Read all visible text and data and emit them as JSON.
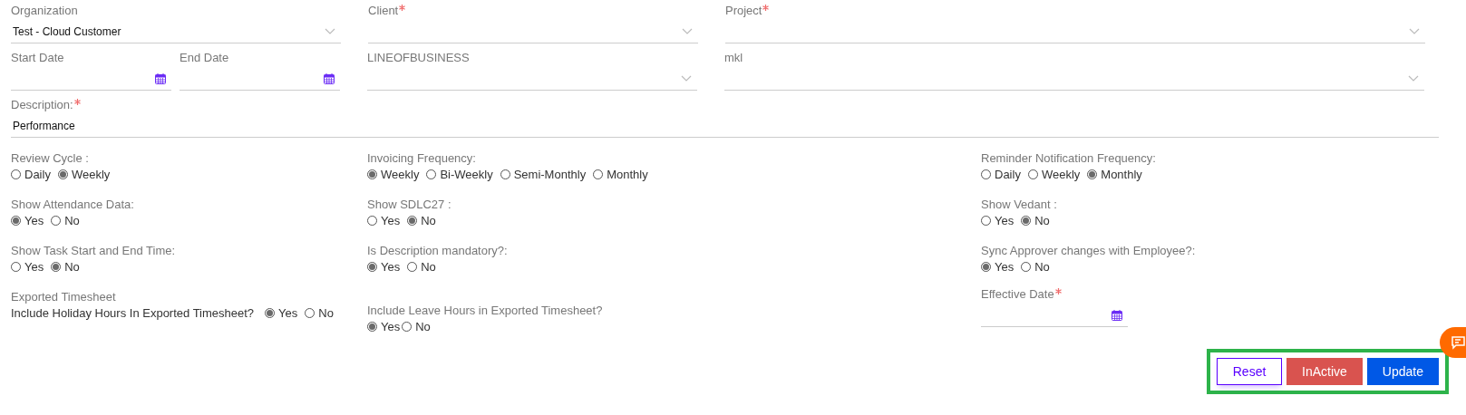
{
  "top_fields": [
    {
      "kind": "select",
      "label": "Organization",
      "required": false,
      "value": "Test - Cloud Customer"
    },
    {
      "kind": "select",
      "label": "Client",
      "required": true
    },
    {
      "kind": "select",
      "label": "Project",
      "required": true
    }
  ],
  "second_fields": [
    {
      "kind": "date",
      "label": "Start Date",
      "required": false
    },
    {
      "kind": "date",
      "label": "End Date",
      "required": false
    },
    {
      "kind": "select",
      "label": "LINEOFBUSINESS",
      "required": false
    },
    {
      "kind": "select",
      "label": "mkl",
      "required": false
    }
  ],
  "description": {
    "label": "Description:",
    "required": true,
    "value": "Performance"
  },
  "option_columns": [
    [
      {
        "kind": "radio",
        "label": "Review Cycle :",
        "options": [
          {
            "label": "Daily",
            "selected": false
          },
          {
            "label": "Weekly",
            "selected": true
          }
        ]
      },
      {
        "kind": "radio",
        "label": "Show Attendance Data:",
        "options": [
          {
            "label": "Yes",
            "selected": true
          },
          {
            "label": "No",
            "selected": false
          }
        ]
      },
      {
        "kind": "radio",
        "label": "Show Task Start and End Time:",
        "options": [
          {
            "label": "Yes",
            "selected": false
          },
          {
            "label": "No",
            "selected": true
          }
        ]
      },
      {
        "kind": "inline-radio",
        "heading": "Exported Timesheet",
        "label": "Include Holiday Hours In Exported Timesheet?",
        "options": [
          {
            "label": "Yes",
            "selected": true
          },
          {
            "label": "No",
            "selected": false
          }
        ]
      }
    ],
    [
      {
        "kind": "radio",
        "label": "Invoicing Frequency:",
        "options": [
          {
            "label": "Weekly",
            "selected": true
          },
          {
            "label": "Bi-Weekly",
            "selected": false
          },
          {
            "label": "Semi-Monthly",
            "selected": false
          },
          {
            "label": "Monthly",
            "selected": false
          }
        ]
      },
      {
        "kind": "radio",
        "label": "Show SDLC27 :",
        "options": [
          {
            "label": "Yes",
            "selected": false
          },
          {
            "label": "No",
            "selected": true
          }
        ]
      },
      {
        "kind": "radio",
        "label": "Is Description mandatory?:",
        "options": [
          {
            "label": "Yes",
            "selected": true
          },
          {
            "label": "No",
            "selected": false
          }
        ]
      },
      {
        "kind": "tight-radio",
        "label": "Include Leave Hours in Exported Timesheet?",
        "options": [
          {
            "label": "Yes",
            "selected": true
          },
          {
            "label": "No",
            "selected": false
          }
        ]
      }
    ],
    [
      {
        "kind": "radio",
        "label": "Reminder Notification Frequency:",
        "options": [
          {
            "label": "Daily",
            "selected": false
          },
          {
            "label": "Weekly",
            "selected": false
          },
          {
            "label": "Monthly",
            "selected": true
          }
        ]
      },
      {
        "kind": "radio",
        "label": "Show Vedant :",
        "options": [
          {
            "label": "Yes",
            "selected": false
          },
          {
            "label": "No",
            "selected": true
          }
        ]
      },
      {
        "kind": "radio",
        "label": "Sync Approver changes with Employee?:",
        "options": [
          {
            "label": "Yes",
            "selected": true
          },
          {
            "label": "No",
            "selected": false
          }
        ]
      },
      {
        "kind": "date",
        "label": "Effective Date",
        "required": true
      }
    ]
  ],
  "buttons": [
    {
      "label": "Reset",
      "kind": "outline"
    },
    {
      "label": "InActive",
      "kind": "danger"
    },
    {
      "label": "Update",
      "kind": "primary"
    }
  ]
}
